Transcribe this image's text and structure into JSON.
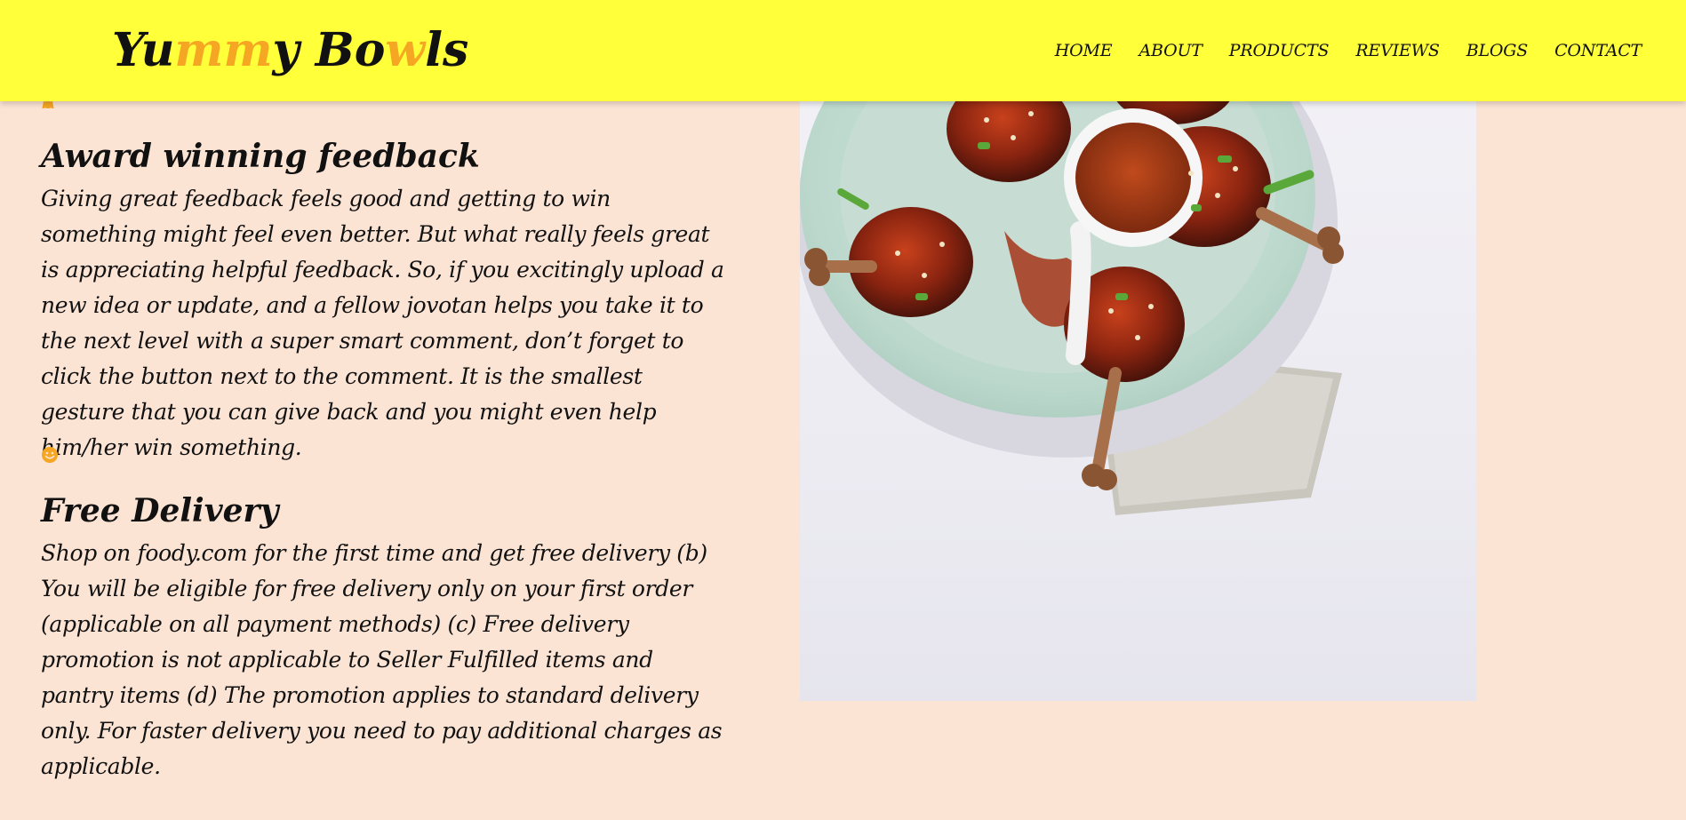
{
  "header": {
    "logo": {
      "part1": "Yu",
      "part2": "mm",
      "part3": "y Bo",
      "part4": "w",
      "part5": "ls"
    },
    "nav": [
      "HOME",
      "ABOUT",
      "PRODUCTS",
      "REVIEWS",
      "BLOGS",
      "CONTACT"
    ]
  },
  "sections": [
    {
      "icon": "award-icon",
      "title": "Award winning feedback",
      "text": "Giving great feedback feels good and getting to win something might feel even better. But what really feels great is appreciating helpful feedback. So, if you excitingly upload a new idea or update, and a fellow jovotan helps you take it to the next level with a super smart comment, don’t forget to click the button next to the comment. It is the smallest gesture that you can give back and you might even help him/her win something."
    },
    {
      "icon": "smile-icon",
      "title": "Free Delivery",
      "text": "Shop on foody.com for the first time and get free delivery (b) You will be eligible for free delivery only on your first order (applicable on all payment methods) (c) Free delivery promotion is not applicable to Seller Fulfilled items and pantry items (d) The promotion applies to standard delivery only. For faster delivery you need to pay additional charges as applicable."
    }
  ],
  "colors": {
    "header_bg": "#ffff3a",
    "page_bg": "#fce4d5",
    "accent": "#f5a623"
  }
}
